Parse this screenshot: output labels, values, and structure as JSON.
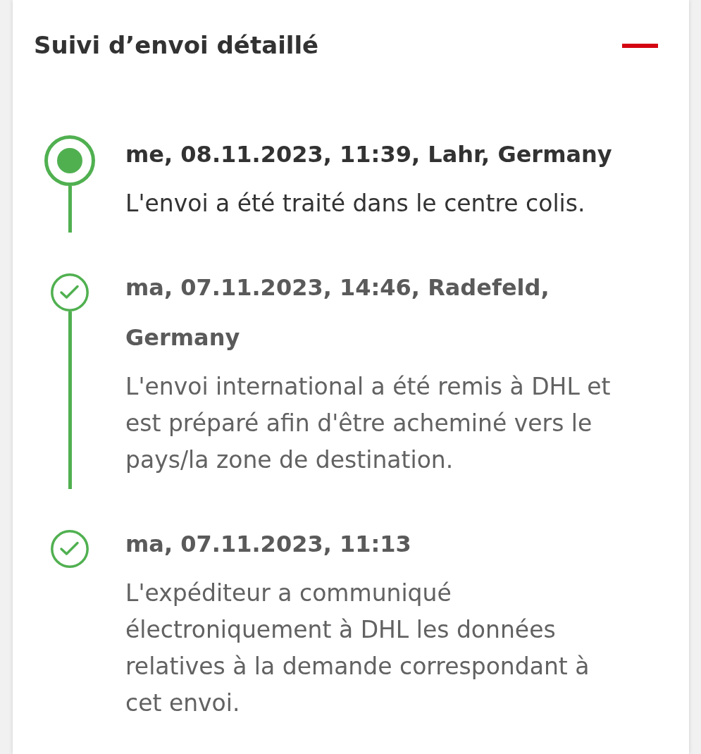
{
  "section": {
    "title": "Suivi d’envoi détaillé",
    "expanded": true
  },
  "events": [
    {
      "heading": "me, 08.11.2023, 11:39, Lahr, Germany",
      "description": "L'envoi a été traité dans le centre colis.",
      "current": true
    },
    {
      "heading": "ma, 07.11.2023, 14:46, Radefeld, Germany",
      "description": "L'envoi international a été remis à DHL et est préparé afin d'être acheminé vers le pays/la zone de destination.",
      "current": false
    },
    {
      "heading": "ma, 07.11.2023, 11:13",
      "description": "L'expéditeur a communiqué électroniquement à DHL les données relatives à la demande correspondant à cet envoi.",
      "current": false
    }
  ]
}
